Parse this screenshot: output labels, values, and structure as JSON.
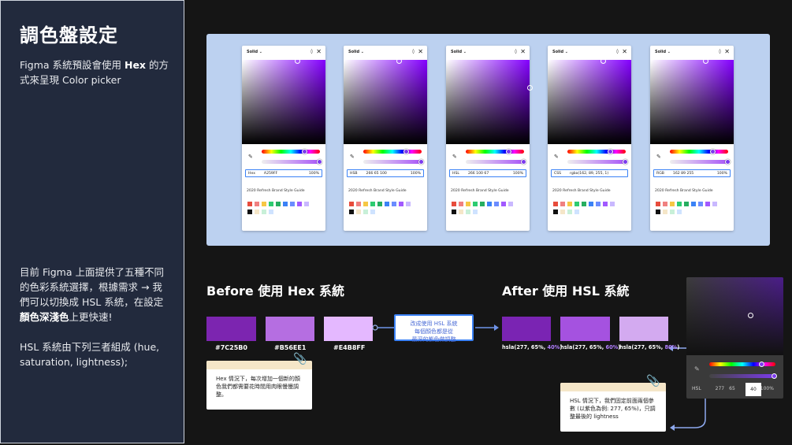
{
  "sidebar": {
    "title": "調色盤設定",
    "p1_prefix": "Figma 系統預設會使用 ",
    "p1_bold": "Hex",
    "p1_suffix": " 的方式來呈現 Color picker",
    "p2_a": "目前 Figma 上面提供了五種不同的色彩系統選擇，根據需求 → 我們可以切換成 HSL 系統，在設定",
    "p2_bold": "顏色深淺色",
    "p2_b": "上更快速!",
    "p3": "HSL 系統由下列三者組成 (hue, saturation, lightness);"
  },
  "picker": {
    "header": "Solid",
    "library": "2020 Refresh Brand Style Guide",
    "panels": [
      {
        "mode": "Hex",
        "value": "A259FF",
        "pct": "100%"
      },
      {
        "mode": "HSB",
        "value": "266   65   100",
        "pct": "100%"
      },
      {
        "mode": "HSL",
        "value": "266   100   67",
        "pct": "100%"
      },
      {
        "mode": "CSS",
        "value": "rgba(162, 89, 255, 1)",
        "pct": ""
      },
      {
        "mode": "RGB",
        "value": "162   89   255",
        "pct": "100%"
      }
    ],
    "swatches_row1": [
      "#e74c3c",
      "#f08080",
      "#f6c744",
      "#2ecc71",
      "#27ae60",
      "#3b82f6",
      "#6b8cff",
      "#a259ff",
      "#c9b8ff"
    ],
    "swatches_row2": [
      "#111111",
      "#f5e6c8",
      "#c8f0d8",
      "#cfe3ff",
      "#ffffff"
    ]
  },
  "before": {
    "title": "Before 使用 Hex 系統",
    "colors": [
      {
        "hex": "#7C25B0",
        "label": "#7C25B0"
      },
      {
        "hex": "#B56EE1",
        "label": "#B56EE1"
      },
      {
        "hex": "#E4B8FF",
        "label": "#E4B8FF"
      }
    ],
    "note": "Hex 情況下，每次增加一個新的顏色我們都需要花時間用肉眼慢慢調整。"
  },
  "center_box": {
    "line1": "改成使用 HSL 系統",
    "line2": "每個顏色都是從",
    "line3": "最深的紫色做調整"
  },
  "after": {
    "title": "After 使用 HSL 系統",
    "colors": [
      {
        "hex": "#7a24b3",
        "prefix": "hsla(277, 65%, ",
        "acc": "40%",
        "suffix": ")"
      },
      {
        "hex": "#a552e0",
        "prefix": "hsla(277, 65%, ",
        "acc": "60%",
        "suffix": ")"
      },
      {
        "hex": "#d3aaf0",
        "prefix": "hsla(277, 65%, ",
        "acc": "80%",
        "suffix": ")"
      }
    ],
    "note": "HSL 情況下，我們固定前面兩個參數 (以紫色為例: 277, 65%)，只調整最後的 lightness"
  },
  "mini_picker": {
    "mode": "HSL",
    "v1": "277",
    "v2": "65",
    "v3": "40",
    "pct": "100%"
  },
  "colors": {
    "sidebar_bg": "#222a3d",
    "panel_bg": "#bcd1f0",
    "accent": "#3b82f6"
  }
}
